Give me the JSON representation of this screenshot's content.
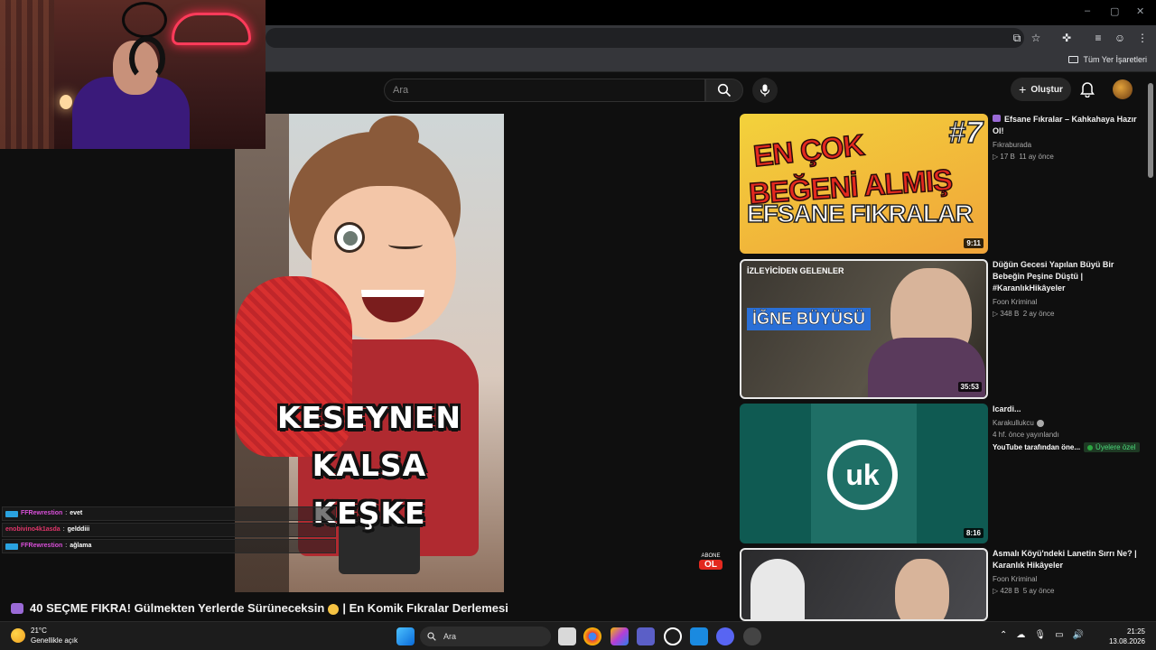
{
  "browser": {
    "window_controls": [
      "–",
      "▢",
      "✕"
    ],
    "bookmarks_label": "Tüm Yer İşaretleri"
  },
  "masthead": {
    "search_placeholder": "Ara",
    "create_label": "Oluştur"
  },
  "player": {
    "caption_lines": [
      "KESEYNEN",
      "KALSA",
      "KEŞKE"
    ],
    "subscribe_top": "ABONE",
    "subscribe_bottom": "OL"
  },
  "video": {
    "title_prefix": "40 SEÇME FIKRA! Gülmekten Yerlerde Sürüneceksin",
    "title_suffix": "| En Komik Fıkralar Derlemesi"
  },
  "chat": [
    {
      "user": "FFRewrestion",
      "msg": "evet",
      "color": "#d94fd9"
    },
    {
      "user": "enobivino4k1asda",
      "msg": "gelddiii",
      "color": "#e0356a"
    },
    {
      "user": "FFRewrestion",
      "msg": "ağlama",
      "color": "#d94fd9"
    }
  ],
  "recommendations": [
    {
      "title": "Efsane Fıkralar – Kahkahaya Hazır Ol!",
      "channel": "Fıkraburada",
      "views": "17 B",
      "age": "11 ay önce",
      "duration": "9:11",
      "thumb_lines": [
        "EN ÇOK",
        "BEĞENİ ALMIŞ",
        "EFSANE FIKRALAR",
        "#7"
      ]
    },
    {
      "title": "Düğün Gecesi Yapılan Büyü Bir Bebeğin Peşine Düştü | #KaranlıkHikâyeler",
      "channel": "Foon Kriminal",
      "views": "348 B",
      "age": "2 ay önce",
      "duration": "35:53",
      "thumb_lines": [
        "İZLEYİCİDEN GELENLER",
        "İĞNE BÜYÜSÜ"
      ]
    },
    {
      "title": "Icardi...",
      "channel": "Karakullukcu",
      "published": "4 hf. önce yayınlandı",
      "extra": "YouTube tarafından öne...",
      "members_label": "Üyelere özel",
      "duration": "8:16",
      "thumb_lines": [
        "uk"
      ]
    },
    {
      "title": "Asmalı Köyü'ndeki Lanetin Sırrı Ne? | Karanlık Hikâyeler",
      "channel": "Foon Kriminal",
      "views": "428 B",
      "age": "5 ay önce"
    }
  ],
  "taskbar": {
    "temperature": "21°C",
    "weather_desc": "Genellikle açık",
    "search_label": "Ara",
    "time": "21:25",
    "date": "13.08.2026"
  }
}
